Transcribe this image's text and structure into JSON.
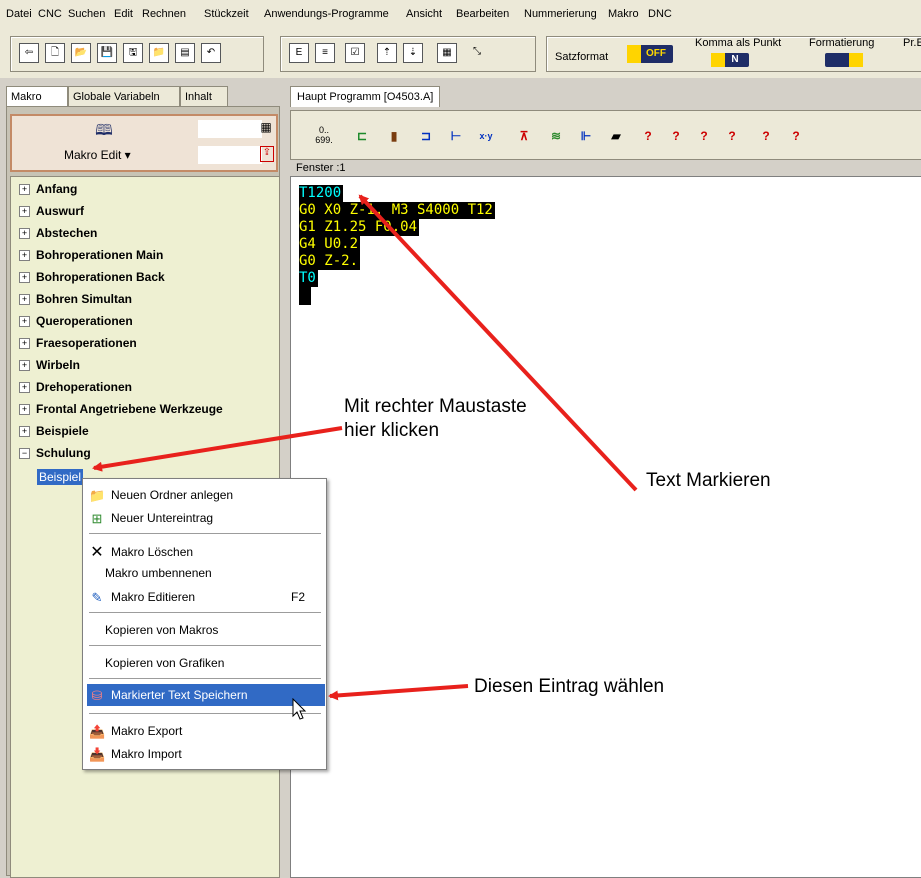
{
  "menu": [
    "Datei",
    "CNC",
    "Suchen",
    "Edit",
    "Rechnen",
    "Stückzeit",
    "Anwendungs-Programme",
    "Ansicht",
    "Bearbeiten",
    "Nummerierung",
    "Makro",
    "DNC"
  ],
  "toolbar": {
    "satzformat_label": "Satzformat",
    "off_label": "OFF",
    "komma_label": "Komma als Punkt",
    "komma_badge": "N",
    "formatierung_label": "Formatierung",
    "pr_label": "Pr.E"
  },
  "left_tabs": [
    "Makro",
    "Globale Variabeln",
    "Inhalt"
  ],
  "macro_edit_label": "Makro Edit ▾",
  "tree": [
    "Anfang",
    "Auswurf",
    "Abstechen",
    "Bohroperationen Main",
    "Bohroperationen Back",
    "Bohren Simultan",
    "Queroperationen",
    "Fraesoperationen",
    "Wirbeln",
    "Drehoperationen",
    "Frontal Angetriebene Werkzeuge",
    "Beispiele",
    "Schulung"
  ],
  "tree_child": "Beispiel",
  "right_tab": "Haupt Programm  [O4503.A]",
  "fenster_label": "Fenster :1",
  "code_lines": [
    {
      "text": "T1200",
      "color": "#00ffff"
    },
    {
      "text": "G0 X0 Z-1. M3 S4000 T12",
      "color": "#ffff00"
    },
    {
      "text": "G1 Z1.25 F0.04",
      "color": "#ffff00"
    },
    {
      "text": "G4 U0.2",
      "color": "#ffff00"
    },
    {
      "text": "G0 Z-2.",
      "color": "#ffff00"
    },
    {
      "text": "T0",
      "color": "#00ffff"
    }
  ],
  "context_menu": {
    "neuer_ordner": "Neuen Ordner anlegen",
    "neuer_untereintrag": "Neuer Untereintrag",
    "makro_loeschen": "Makro Löschen",
    "makro_umbenennen": "Makro umbennenen",
    "makro_editieren": "Makro Editieren",
    "makro_editieren_shortcut": "F2",
    "kopieren_makros": "Kopieren von Makros",
    "kopieren_grafiken": "Kopieren von Grafiken",
    "markierter_text": "Markierter Text Speichern",
    "makro_export": "Makro Export",
    "makro_import": "Makro Import"
  },
  "annotations": {
    "rechte_maustaste_1": "Mit rechter Maustaste",
    "rechte_maustaste_2": "hier klicken",
    "text_markieren": "Text Markieren",
    "eintrag_waehlen": "Diesen Eintrag wählen"
  },
  "colors": {
    "highlight": "#316ac5",
    "arrow": "#e8211c",
    "tree_bg": "#eef0d2",
    "code_bg": "#000000"
  }
}
